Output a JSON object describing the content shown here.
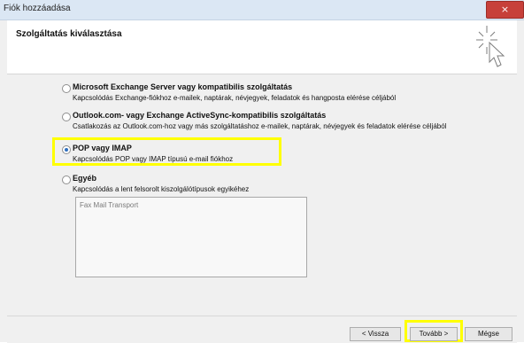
{
  "window": {
    "title": "Fiók hozzáadása",
    "close_glyph": "×"
  },
  "header": {
    "title": "Szolgáltatás kiválasztása",
    "icon": "sparkle-cursor-icon"
  },
  "options": [
    {
      "label": "Microsoft Exchange Server vagy kompatibilis szolgáltatás",
      "description": "Kapcsolódás Exchange-fiókhoz e-mailek, naptárak, névjegyek, feladatok és hangposta elérése céljából",
      "selected": false
    },
    {
      "label": "Outlook.com- vagy Exchange ActiveSync-kompatibilis szolgáltatás",
      "description": "Csatlakozás az Outlook.com-hoz vagy más szolgáltatáshoz e-mailek, naptárak, névjegyek és feladatok elérése céljából",
      "selected": false
    },
    {
      "label": "POP vagy IMAP",
      "description": "Kapcsolódás POP vagy IMAP típusú e-mail fiókhoz",
      "selected": true
    },
    {
      "label": "Egyéb",
      "description": "Kapcsolódás a lent felsorolt kiszolgálótípusok egyikéhez",
      "selected": false
    }
  ],
  "other_server_list": [
    "Fax Mail Transport"
  ],
  "footer": {
    "back_label": "< Vissza",
    "next_label": "Tovább >",
    "cancel_label": "Mégse"
  },
  "highlight_color": "#ffff00"
}
